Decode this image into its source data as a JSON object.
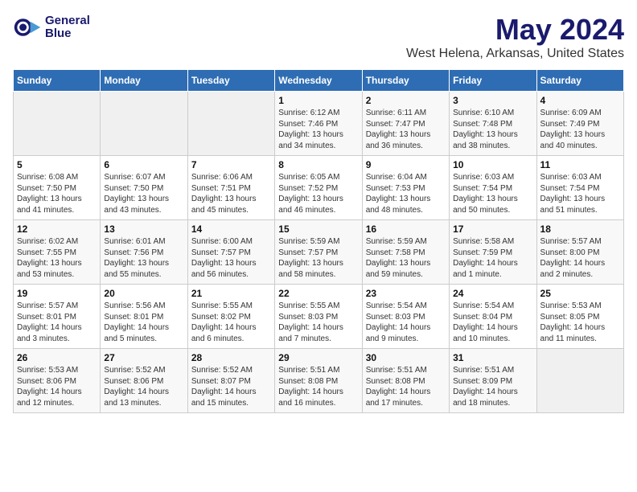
{
  "logo": {
    "line1": "General",
    "line2": "Blue"
  },
  "title": "May 2024",
  "subtitle": "West Helena, Arkansas, United States",
  "days_header": [
    "Sunday",
    "Monday",
    "Tuesday",
    "Wednesday",
    "Thursday",
    "Friday",
    "Saturday"
  ],
  "weeks": [
    [
      {
        "num": "",
        "info": ""
      },
      {
        "num": "",
        "info": ""
      },
      {
        "num": "",
        "info": ""
      },
      {
        "num": "1",
        "info": "Sunrise: 6:12 AM\nSunset: 7:46 PM\nDaylight: 13 hours\nand 34 minutes."
      },
      {
        "num": "2",
        "info": "Sunrise: 6:11 AM\nSunset: 7:47 PM\nDaylight: 13 hours\nand 36 minutes."
      },
      {
        "num": "3",
        "info": "Sunrise: 6:10 AM\nSunset: 7:48 PM\nDaylight: 13 hours\nand 38 minutes."
      },
      {
        "num": "4",
        "info": "Sunrise: 6:09 AM\nSunset: 7:49 PM\nDaylight: 13 hours\nand 40 minutes."
      }
    ],
    [
      {
        "num": "5",
        "info": "Sunrise: 6:08 AM\nSunset: 7:50 PM\nDaylight: 13 hours\nand 41 minutes."
      },
      {
        "num": "6",
        "info": "Sunrise: 6:07 AM\nSunset: 7:50 PM\nDaylight: 13 hours\nand 43 minutes."
      },
      {
        "num": "7",
        "info": "Sunrise: 6:06 AM\nSunset: 7:51 PM\nDaylight: 13 hours\nand 45 minutes."
      },
      {
        "num": "8",
        "info": "Sunrise: 6:05 AM\nSunset: 7:52 PM\nDaylight: 13 hours\nand 46 minutes."
      },
      {
        "num": "9",
        "info": "Sunrise: 6:04 AM\nSunset: 7:53 PM\nDaylight: 13 hours\nand 48 minutes."
      },
      {
        "num": "10",
        "info": "Sunrise: 6:03 AM\nSunset: 7:54 PM\nDaylight: 13 hours\nand 50 minutes."
      },
      {
        "num": "11",
        "info": "Sunrise: 6:03 AM\nSunset: 7:54 PM\nDaylight: 13 hours\nand 51 minutes."
      }
    ],
    [
      {
        "num": "12",
        "info": "Sunrise: 6:02 AM\nSunset: 7:55 PM\nDaylight: 13 hours\nand 53 minutes."
      },
      {
        "num": "13",
        "info": "Sunrise: 6:01 AM\nSunset: 7:56 PM\nDaylight: 13 hours\nand 55 minutes."
      },
      {
        "num": "14",
        "info": "Sunrise: 6:00 AM\nSunset: 7:57 PM\nDaylight: 13 hours\nand 56 minutes."
      },
      {
        "num": "15",
        "info": "Sunrise: 5:59 AM\nSunset: 7:57 PM\nDaylight: 13 hours\nand 58 minutes."
      },
      {
        "num": "16",
        "info": "Sunrise: 5:59 AM\nSunset: 7:58 PM\nDaylight: 13 hours\nand 59 minutes."
      },
      {
        "num": "17",
        "info": "Sunrise: 5:58 AM\nSunset: 7:59 PM\nDaylight: 14 hours\nand 1 minute."
      },
      {
        "num": "18",
        "info": "Sunrise: 5:57 AM\nSunset: 8:00 PM\nDaylight: 14 hours\nand 2 minutes."
      }
    ],
    [
      {
        "num": "19",
        "info": "Sunrise: 5:57 AM\nSunset: 8:01 PM\nDaylight: 14 hours\nand 3 minutes."
      },
      {
        "num": "20",
        "info": "Sunrise: 5:56 AM\nSunset: 8:01 PM\nDaylight: 14 hours\nand 5 minutes."
      },
      {
        "num": "21",
        "info": "Sunrise: 5:55 AM\nSunset: 8:02 PM\nDaylight: 14 hours\nand 6 minutes."
      },
      {
        "num": "22",
        "info": "Sunrise: 5:55 AM\nSunset: 8:03 PM\nDaylight: 14 hours\nand 7 minutes."
      },
      {
        "num": "23",
        "info": "Sunrise: 5:54 AM\nSunset: 8:03 PM\nDaylight: 14 hours\nand 9 minutes."
      },
      {
        "num": "24",
        "info": "Sunrise: 5:54 AM\nSunset: 8:04 PM\nDaylight: 14 hours\nand 10 minutes."
      },
      {
        "num": "25",
        "info": "Sunrise: 5:53 AM\nSunset: 8:05 PM\nDaylight: 14 hours\nand 11 minutes."
      }
    ],
    [
      {
        "num": "26",
        "info": "Sunrise: 5:53 AM\nSunset: 8:06 PM\nDaylight: 14 hours\nand 12 minutes."
      },
      {
        "num": "27",
        "info": "Sunrise: 5:52 AM\nSunset: 8:06 PM\nDaylight: 14 hours\nand 13 minutes."
      },
      {
        "num": "28",
        "info": "Sunrise: 5:52 AM\nSunset: 8:07 PM\nDaylight: 14 hours\nand 15 minutes."
      },
      {
        "num": "29",
        "info": "Sunrise: 5:51 AM\nSunset: 8:08 PM\nDaylight: 14 hours\nand 16 minutes."
      },
      {
        "num": "30",
        "info": "Sunrise: 5:51 AM\nSunset: 8:08 PM\nDaylight: 14 hours\nand 17 minutes."
      },
      {
        "num": "31",
        "info": "Sunrise: 5:51 AM\nSunset: 8:09 PM\nDaylight: 14 hours\nand 18 minutes."
      },
      {
        "num": "",
        "info": ""
      }
    ]
  ]
}
